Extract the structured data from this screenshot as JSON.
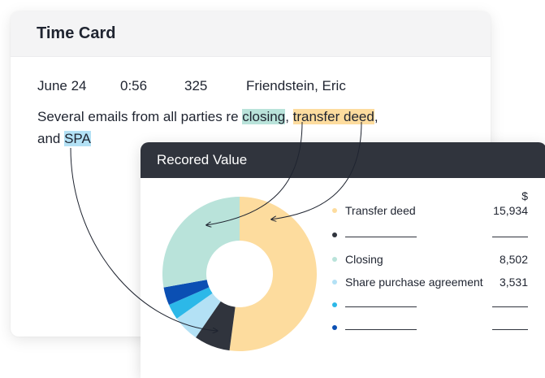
{
  "timecard": {
    "title": "Time Card",
    "entry": {
      "date": "June 24",
      "duration": "0:56",
      "code": "325",
      "name": "Friendstein, Eric"
    },
    "description": {
      "prefix": "Several emails from all parties re ",
      "closing": "closing",
      "sep1": ", ",
      "transfer": "transfer deed",
      "sep2": ",",
      "and": "and ",
      "spa": "SPA"
    }
  },
  "value_card": {
    "title": "Recored Value",
    "currency": "$",
    "legend": [
      {
        "label": "Transfer deed",
        "value": "15,934",
        "color": "#fddc9e"
      },
      {
        "label": "",
        "value": "",
        "color": "#30343d"
      },
      {
        "label": "Closing",
        "value": "8,502",
        "color": "#b9e3da"
      },
      {
        "label": "Share purchase agreement",
        "value": "3,531",
        "color": "#b3e1f5"
      },
      {
        "label": "",
        "value": "",
        "color": "#2cb8e8"
      },
      {
        "label": "",
        "value": "",
        "color": "#0b4fb3"
      }
    ]
  },
  "chart_data": {
    "type": "pie",
    "donut": true,
    "categories": [
      "Transfer deed",
      "",
      "",
      "",
      "",
      "Closing"
    ],
    "values": [
      15934,
      2300,
      1700,
      1000,
      1150,
      8502
    ],
    "colors": [
      "#fddc9e",
      "#30343d",
      "#b3e1f5",
      "#2cb8e8",
      "#0b4fb3",
      "#b9e3da"
    ]
  }
}
